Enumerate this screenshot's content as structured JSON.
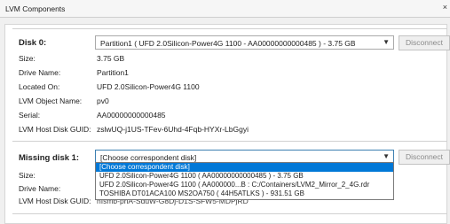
{
  "window": {
    "title": "LVM Components",
    "close_glyph": "×"
  },
  "disk0": {
    "heading": "Disk 0:",
    "partition_select": "Partition1 ( UFD 2.0Silicon-Power4G 1100 - AA00000000000485 ) - 3.75 GB",
    "disconnect_label": "Disconnect",
    "fields": [
      {
        "label": "Size:",
        "value": "3.75 GB"
      },
      {
        "label": "Drive Name:",
        "value": "Partition1"
      },
      {
        "label": "Located On:",
        "value": "UFD 2.0Silicon-Power4G 1100"
      },
      {
        "label": "LVM Object Name:",
        "value": "pv0"
      },
      {
        "label": "Serial:",
        "value": "AA00000000000485"
      },
      {
        "label": "LVM Host Disk GUID:",
        "value": "zslwUQ-j1US-TFev-6Uhd-4Fqb-HYXr-LbGgyi"
      }
    ]
  },
  "missing_disk1": {
    "heading": "Missing disk 1:",
    "select_value": "[Choose correspondent disk]",
    "disconnect_label": "Disconnect",
    "fields": [
      {
        "label": "Size:"
      },
      {
        "label": "Drive Name:"
      },
      {
        "label": "LVM Host Disk GUID:",
        "value": "hIsmb-pnA-SduW-G8Dj-D1S-SFW5-MDPjRD"
      }
    ],
    "options": [
      "[Choose correspondent disk]",
      "UFD 2.0Silicon-Power4G 1100 ( AA00000000000485 ) - 3.75 GB",
      "UFD 2.0Silicon-Power4G 1100 ( AA000000...B : C:/Containers/LVM2_Mirror_2_4G.rdr",
      "TOSHIBA DT01ACA100 MS2OA750 ( 44H5ATLKS ) - 931.51 GB"
    ],
    "selected_option_index": 0
  },
  "icons": {
    "dropdown_arrow": "chevron-down-icon",
    "close": "close-icon"
  },
  "colors": {
    "selection": "#0078d7",
    "focus_border": "#3c7fb1"
  }
}
